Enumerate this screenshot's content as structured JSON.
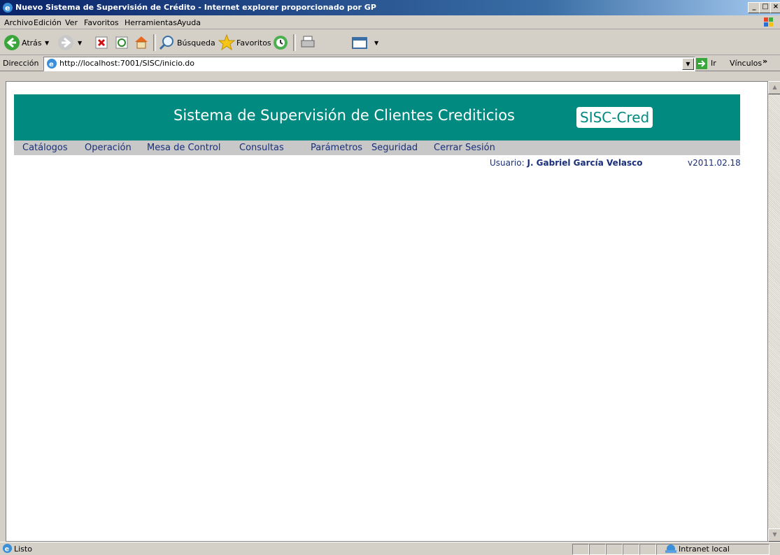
{
  "window": {
    "title": "Nuevo Sistema de Supervisión de Crédito - Internet explorer proporcionado por GP",
    "minimize": "_",
    "maximize": "□",
    "close": "×"
  },
  "menubar": {
    "items": [
      {
        "label": "Archivo"
      },
      {
        "label": "Edición"
      },
      {
        "label": "Ver"
      },
      {
        "label": "Favoritos"
      },
      {
        "label": "Herramientas"
      },
      {
        "label": "Ayuda"
      }
    ]
  },
  "toolbar": {
    "back_label": "Atrás",
    "search_label": "Búsqueda",
    "favorites_label": "Favoritos"
  },
  "addressbar": {
    "label": "Dirección",
    "url": "http://localhost:7001/SISC/inicio.do",
    "go_label": "Ir",
    "links_label": "Vínculos"
  },
  "page": {
    "title": "Sistema de Supervisión de Clientes Crediticios",
    "logo": "SISC-Cred",
    "nav": [
      {
        "label": "Catálogos"
      },
      {
        "label": "Operación"
      },
      {
        "label": "Mesa de Control"
      },
      {
        "label": "Consultas"
      },
      {
        "label": "Parámetros"
      },
      {
        "label": "Seguridad"
      },
      {
        "label": "Cerrar Sesión"
      }
    ],
    "user_label": "Usuario:",
    "user_name": "J. Gabriel García Velasco",
    "version": "v2011.02.18"
  },
  "statusbar": {
    "status": "Listo",
    "zone": "Intranet local"
  },
  "colors": {
    "banner": "#008a80",
    "nav_bg": "#c8c8c8",
    "nav_text": "#1a2f7a"
  }
}
